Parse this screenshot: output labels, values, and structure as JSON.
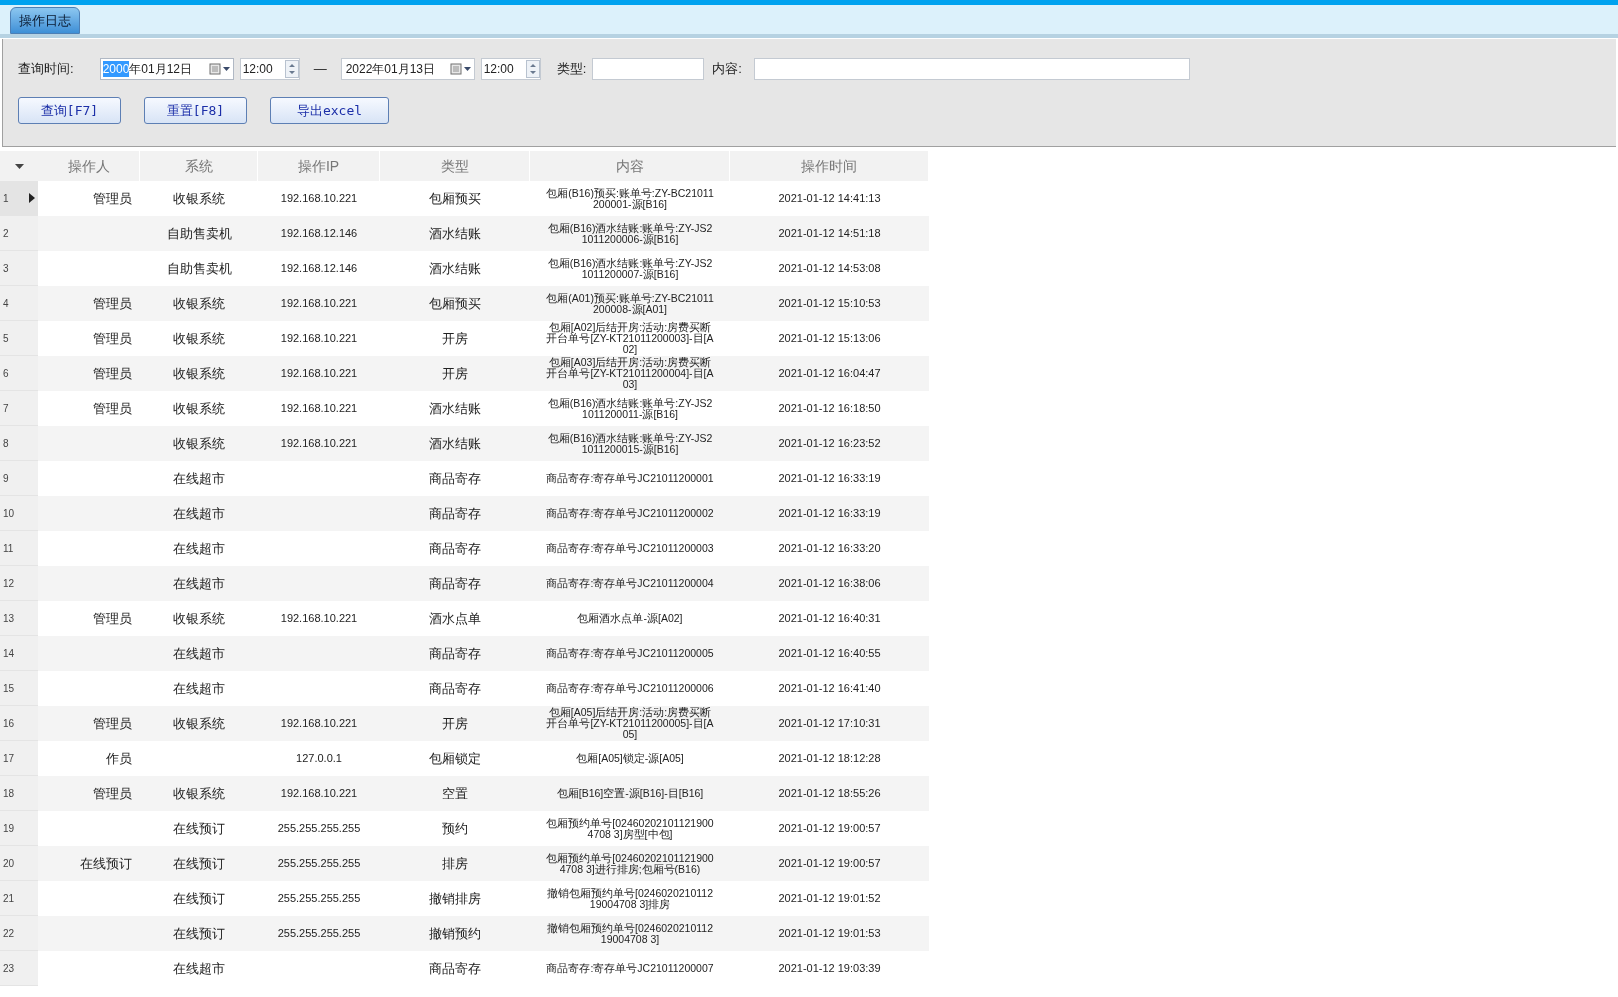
{
  "tabs": [
    {
      "label": "操作日志",
      "selected": true
    }
  ],
  "filter": {
    "time_label": "查询时间:",
    "start_date": {
      "selected_part": "2000",
      "rest": "年01月12日"
    },
    "start_time": "12:00",
    "separator": "—",
    "end_date": {
      "rest": "2022年01月13日"
    },
    "end_time": "12:00",
    "type_label": "类型:",
    "content_label": "内容:"
  },
  "buttons": [
    "查询[F7]",
    "重置[F8]",
    "导出excel"
  ],
  "table": {
    "columns": [
      "操作人",
      "系统",
      "操作IP",
      "类型",
      "内容",
      "操作时间"
    ],
    "rows": [
      {
        "index": "1",
        "current": true,
        "operator": "管理员",
        "system": "收银系统",
        "ip": "192.168.10.221",
        "type": "包厢预买",
        "content": "包厢(B16)预买:账单号:ZY-BC21011200001-源[B16]",
        "time": "2021-01-12 14:41:13"
      },
      {
        "index": "2",
        "current": false,
        "system": "自助售卖机",
        "ip": "192.168.12.146",
        "type": "酒水结账",
        "content": "包厢(B16)酒水结账:账单号:ZY-JS21011200006-源[B16]",
        "time": "2021-01-12 14:51:18"
      },
      {
        "index": "3",
        "current": false,
        "system": "自助售卖机",
        "ip": "192.168.12.146",
        "type": "酒水结账",
        "content": "包厢(B16)酒水结账:账单号:ZY-JS21011200007-源[B16]",
        "time": "2021-01-12 14:53:08"
      },
      {
        "index": "4",
        "current": false,
        "operator": "管理员",
        "system": "收银系统",
        "ip": "192.168.10.221",
        "type": "包厢预买",
        "content": "包厢(A01)预买:账单号:ZY-BC21011200008-源[A01]",
        "time": "2021-01-12 15:10:53"
      },
      {
        "index": "5",
        "current": false,
        "operator": "管理员",
        "system": "收银系统",
        "ip": "192.168.10.221",
        "type": "开房",
        "content": "包厢[A02]后结开房:活动:房费买断开台单号[ZY-KT21011200003]-目[A02]",
        "time": "2021-01-12 15:13:06"
      },
      {
        "index": "6",
        "current": false,
        "operator": "管理员",
        "system": "收银系统",
        "ip": "192.168.10.221",
        "type": "开房",
        "content": "包厢[A03]后结开房:活动:房费买断开台单号[ZY-KT21011200004]-目[A03]",
        "time": "2021-01-12 16:04:47"
      },
      {
        "index": "7",
        "current": false,
        "operator": "管理员",
        "system": "收银系统",
        "ip": "192.168.10.221",
        "type": "酒水结账",
        "content": "包厢(B16)酒水结账:账单号:ZY-JS21011200011-源[B16]",
        "time": "2021-01-12 16:18:50"
      },
      {
        "index": "8",
        "current": false,
        "system": "收银系统",
        "ip": "192.168.10.221",
        "type": "酒水结账",
        "content": "包厢(B16)酒水结账:账单号:ZY-JS21011200015-源[B16]",
        "time": "2021-01-12 16:23:52"
      },
      {
        "index": "9",
        "current": false,
        "system": "在线超市",
        "type": "商品寄存",
        "content": "商品寄存:寄存单号JC21011200001",
        "time": "2021-01-12 16:33:19"
      },
      {
        "index": "10",
        "current": false,
        "system": "在线超市",
        "type": "商品寄存",
        "content": "商品寄存:寄存单号JC21011200002",
        "time": "2021-01-12 16:33:19"
      },
      {
        "index": "11",
        "current": false,
        "system": "在线超市",
        "type": "商品寄存",
        "content": "商品寄存:寄存单号JC21011200003",
        "time": "2021-01-12 16:33:20"
      },
      {
        "index": "12",
        "current": false,
        "system": "在线超市",
        "type": "商品寄存",
        "content": "商品寄存:寄存单号JC21011200004",
        "time": "2021-01-12 16:38:06"
      },
      {
        "index": "13",
        "current": false,
        "operator": "管理员",
        "system": "收银系统",
        "ip": "192.168.10.221",
        "type": "酒水点单",
        "content": "包厢酒水点单-源[A02]",
        "time": "2021-01-12 16:40:31"
      },
      {
        "index": "14",
        "current": false,
        "system": "在线超市",
        "type": "商品寄存",
        "content": "商品寄存:寄存单号JC21011200005",
        "time": "2021-01-12 16:40:55"
      },
      {
        "index": "15",
        "current": false,
        "system": "在线超市",
        "type": "商品寄存",
        "content": "商品寄存:寄存单号JC21011200006",
        "time": "2021-01-12 16:41:40"
      },
      {
        "index": "16",
        "current": false,
        "operator": "管理员",
        "system": "收银系统",
        "ip": "192.168.10.221",
        "type": "开房",
        "content": "包厢[A05]后结开房:活动:房费买断开台单号[ZY-KT21011200005]-目[A05]",
        "time": "2021-01-12 17:10:31"
      },
      {
        "index": "17",
        "current": false,
        "operator": "作员",
        "ip": "127.0.0.1",
        "type": "包厢锁定",
        "content": "包厢[A05]锁定-源[A05]",
        "time": "2021-01-12 18:12:28"
      },
      {
        "index": "18",
        "current": false,
        "operator": "管理员",
        "system": "收银系统",
        "ip": "192.168.10.221",
        "type": "空置",
        "content": "包厢[B16]空置-源[B16]-目[B16]",
        "time": "2021-01-12 18:55:26"
      },
      {
        "index": "19",
        "current": false,
        "system": "在线预订",
        "ip": "255.255.255.255",
        "type": "预约",
        "content": "包厢预约单号[024602021011219004708 3]房型[中包]",
        "time": "2021-01-12 19:00:57"
      },
      {
        "index": "20",
        "current": false,
        "operator": "在线预订",
        "system": "在线预订",
        "ip": "255.255.255.255",
        "type": "排房",
        "content": "包厢预约单号[024602021011219004708 3]进行排房;包厢号(B16)",
        "time": "2021-01-12 19:00:57"
      },
      {
        "index": "21",
        "current": false,
        "system": "在线预订",
        "ip": "255.255.255.255",
        "type": "撤销排房",
        "content": "撤销包厢预约单号[024602021011219004708 3]排房",
        "time": "2021-01-12 19:01:52"
      },
      {
        "index": "22",
        "current": false,
        "system": "在线预订",
        "ip": "255.255.255.255",
        "type": "撤销预约",
        "content": "撤销包厢预约单号[024602021011219004708 3]",
        "time": "2021-01-12 19:01:53"
      },
      {
        "index": "23",
        "current": false,
        "system": "在线超市",
        "type": "商品寄存",
        "content": "商品寄存:寄存单号JC21011200007",
        "time": "2021-01-12 19:03:39"
      }
    ]
  }
}
